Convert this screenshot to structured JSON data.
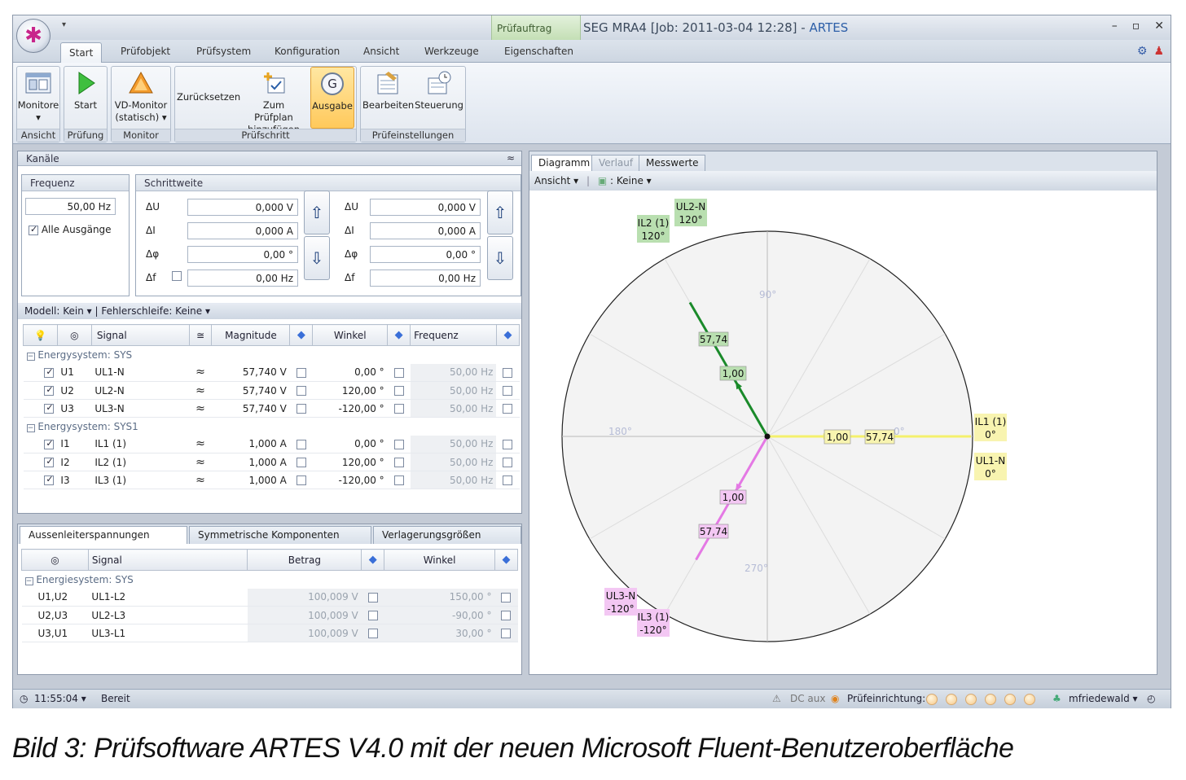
{
  "window": {
    "context_tab": "Prüfauftrag",
    "title_main": "SEG MRA4 [Job: 2011-03-04 12:28] - ",
    "title_app": "ARTES",
    "controls": [
      "–",
      "▫",
      "✕"
    ]
  },
  "tabs": [
    "Start",
    "Prüfobjekt",
    "Prüfsystem",
    "Konfiguration",
    "Ansicht",
    "Werkzeuge",
    "Eigenschaften"
  ],
  "ribbon": {
    "groups": [
      {
        "label": "Ansicht",
        "buttons": [
          {
            "l1": "Monitore",
            "l2": "▾"
          }
        ]
      },
      {
        "label": "Prüfung",
        "buttons": [
          {
            "l1": "Start",
            "l2": ""
          }
        ]
      },
      {
        "label": "Monitor",
        "buttons": [
          {
            "l1": "VD-Monitor",
            "l2": "(statisch) ▾"
          }
        ]
      },
      {
        "label": "Prüfschritt",
        "buttons": [
          {
            "l1": "Zurücksetzen",
            "l2": ""
          },
          {
            "l1": "Zum Prüfplan",
            "l2": "hinzufügen"
          },
          {
            "l1": "Ausgabe",
            "l2": ""
          }
        ]
      },
      {
        "label": "Prüfeinstellungen",
        "buttons": [
          {
            "l1": "Bearbeiten",
            "l2": ""
          },
          {
            "l1": "Steuerung",
            "l2": ""
          }
        ]
      }
    ]
  },
  "channels": {
    "header": "Kanäle",
    "freq_title": "Frequenz",
    "freq_value": "50,00 Hz",
    "all_outputs": "Alle Ausgänge",
    "step_title": "Schrittweite",
    "steps_left": [
      {
        "label": "ΔU",
        "value": "0,000 V"
      },
      {
        "label": "ΔI",
        "value": "0,000 A"
      },
      {
        "label": "Δφ",
        "value": "0,00 °"
      },
      {
        "label": "Δf",
        "value": "0,00 Hz"
      }
    ],
    "steps_right": [
      {
        "label": "ΔU",
        "value": "0,000 V"
      },
      {
        "label": "ΔI",
        "value": "0,000 A"
      },
      {
        "label": "Δφ",
        "value": "0,00 °"
      },
      {
        "label": "Δf",
        "value": "0,00 Hz"
      }
    ],
    "model_bar": "Modell: Kein ▾  |  Fehlerschleife: Keine ▾"
  },
  "signal_table": {
    "headers": {
      "signal": "Signal",
      "magnitude": "Magnitude",
      "angle": "Winkel",
      "frequency": "Frequenz"
    },
    "groups": [
      {
        "name": "Energysystem: SYS",
        "rows": [
          {
            "id": "U1",
            "signal": "UL1-N",
            "mag": "57,740 V",
            "ang": "0,00 °",
            "freq": "50,00 Hz"
          },
          {
            "id": "U2",
            "signal": "UL2-N",
            "mag": "57,740 V",
            "ang": "120,00 °",
            "freq": "50,00 Hz"
          },
          {
            "id": "U3",
            "signal": "UL3-N",
            "mag": "57,740 V",
            "ang": "-120,00 °",
            "freq": "50,00 Hz"
          }
        ]
      },
      {
        "name": "Energysystem: SYS1",
        "rows": [
          {
            "id": "I1",
            "signal": "IL1 (1)",
            "mag": "1,000 A",
            "ang": "0,00 °",
            "freq": "50,00 Hz"
          },
          {
            "id": "I2",
            "signal": "IL2 (1)",
            "mag": "1,000 A",
            "ang": "120,00 °",
            "freq": "50,00 Hz"
          },
          {
            "id": "I3",
            "signal": "IL3 (1)",
            "mag": "1,000 A",
            "ang": "-120,00 °",
            "freq": "50,00 Hz"
          }
        ]
      }
    ]
  },
  "bottom": {
    "tabs": [
      "Aussenleiterspannungen",
      "Symmetrische Komponenten",
      "Verlagerungsgrößen"
    ],
    "headers": {
      "signal": "Signal",
      "amount": "Betrag",
      "angle": "Winkel"
    },
    "group": "Energiesystem: SYS",
    "rows": [
      {
        "id": "U1,U2",
        "signal": "UL1-L2",
        "amount": "100,009 V",
        "angle": "150,00 °"
      },
      {
        "id": "U2,U3",
        "signal": "UL2-L3",
        "amount": "100,009 V",
        "angle": "-90,00 °"
      },
      {
        "id": "U3,U1",
        "signal": "UL3-L1",
        "amount": "100,009 V",
        "angle": "30,00 °"
      }
    ]
  },
  "diagram": {
    "tabs": [
      "Diagramm",
      "Verlauf",
      "Messwerte"
    ],
    "tool_view": "Ansicht ▾",
    "tool_filter": ": Keine ▾",
    "axis_labels": [
      "90°",
      "180°",
      "0°",
      "270°"
    ],
    "phasors": [
      {
        "angle": 0,
        "color": "#f4f06c",
        "mag_label": "57,74",
        "cur_label": "1,00"
      },
      {
        "angle": 120,
        "color": "#1a8a2a",
        "mag_label": "57,74",
        "cur_label": "1,00"
      },
      {
        "angle": -120,
        "color": "#e479e4",
        "mag_label": "57,74",
        "cur_label": "1,00"
      }
    ],
    "outer_labels": [
      {
        "text": "IL1 (1)",
        "sub": "0°",
        "bg": "#f8f4b0"
      },
      {
        "text": "UL1-N",
        "sub": "0°",
        "bg": "#f8f4b0"
      },
      {
        "text": "UL2-N",
        "sub": "120°",
        "bg": "#b9dfb0"
      },
      {
        "text": "IL2 (1)",
        "sub": "120°",
        "bg": "#b9dfb0"
      },
      {
        "text": "UL3-N",
        "sub": "-120°",
        "bg": "#f3c7f3"
      },
      {
        "text": "IL3 (1)",
        "sub": "-120°",
        "bg": "#f3c7f3"
      }
    ]
  },
  "status": {
    "time": "11:55:04 ▾",
    "state": "Bereit",
    "dc": "DC aux",
    "direction": "Prüfeinrichtung:",
    "user": "mfriedewald ▾"
  },
  "caption": "Bild 3: Prüfsoftware ARTES V4.0 mit der neuen Microsoft Fluent-Benutzeroberfläche"
}
